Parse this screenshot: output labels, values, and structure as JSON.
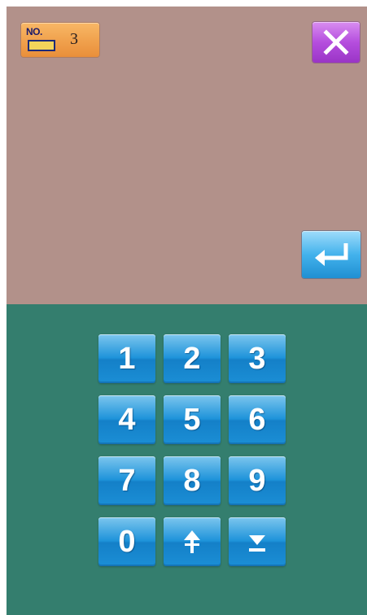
{
  "header": {
    "no_label": "NO.",
    "no_value": "3"
  },
  "buttons": {
    "close_icon": "close-icon",
    "enter_icon": "enter-icon"
  },
  "keypad": {
    "keys": [
      "1",
      "2",
      "3",
      "4",
      "5",
      "6",
      "7",
      "8",
      "9",
      "0"
    ],
    "up_icon": "up-arrow-icon",
    "down_icon": "down-arrow-icon"
  },
  "colors": {
    "top_panel": "#b2918a",
    "bottom_panel": "#347e6e",
    "key_blue": "#1e93da",
    "close_purple": "#b54ede",
    "badge_orange": "#f0a04c"
  }
}
